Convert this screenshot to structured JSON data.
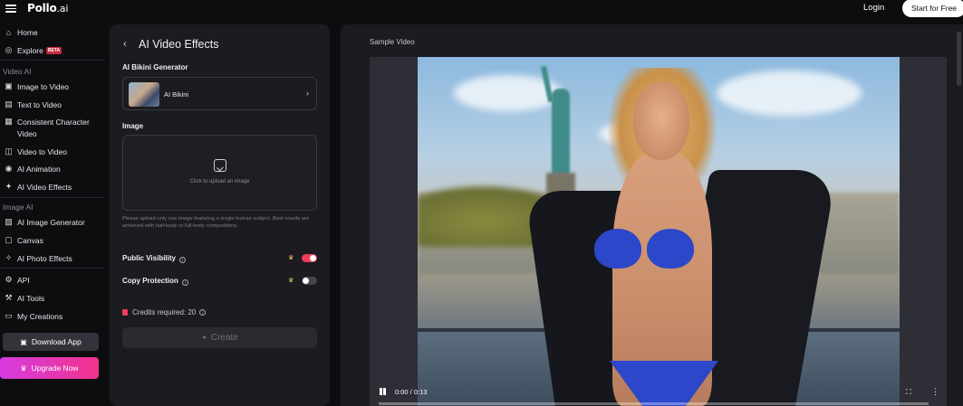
{
  "header": {
    "logo_main": "Pollo",
    "logo_suffix": ".ai",
    "login": "Login",
    "start": "Start for Free"
  },
  "sidebar": {
    "home": "Home",
    "explore": "Explore",
    "explore_badge": "BETA",
    "section_video": "Video AI",
    "image_to_video": "Image to Video",
    "text_to_video": "Text to Video",
    "consistent_line1": "Consistent Character",
    "consistent_line2": "Video",
    "video_to_video": "Video to Video",
    "ai_animation": "AI Animation",
    "ai_video_effects": "AI Video Effects",
    "section_image": "Image AI",
    "ai_image_generator": "AI Image Generator",
    "canvas": "Canvas",
    "ai_photo_effects": "AI Photo Effects",
    "api": "API",
    "ai_tools": "AI Tools",
    "my_creations": "My Creations",
    "download_app": "Download App",
    "upgrade_now": "Upgrade Now"
  },
  "panel": {
    "title": "AI Video Effects",
    "generator_label": "AI Bikini Generator",
    "selected_effect": "AI Bikini",
    "image_label": "Image",
    "upload_text": "Click to upload an image",
    "help_text": "Please upload only one image featuring a single human subject. Best results are achieved with half-body or full-body compositions.",
    "public_visibility": "Public Visibility",
    "public_visibility_on": true,
    "copy_protection": "Copy Protection",
    "copy_protection_on": false,
    "credits": "Credits required: 20",
    "create": "Create"
  },
  "video": {
    "label": "Sample Video",
    "time": "0:00 / 0:13",
    "progress": 0
  },
  "colors": {
    "accent_pink": "#ef3d5b",
    "upgrade_gradient_start": "#d63be0",
    "upgrade_gradient_end": "#f0338c",
    "start_button": "#ffffff"
  }
}
